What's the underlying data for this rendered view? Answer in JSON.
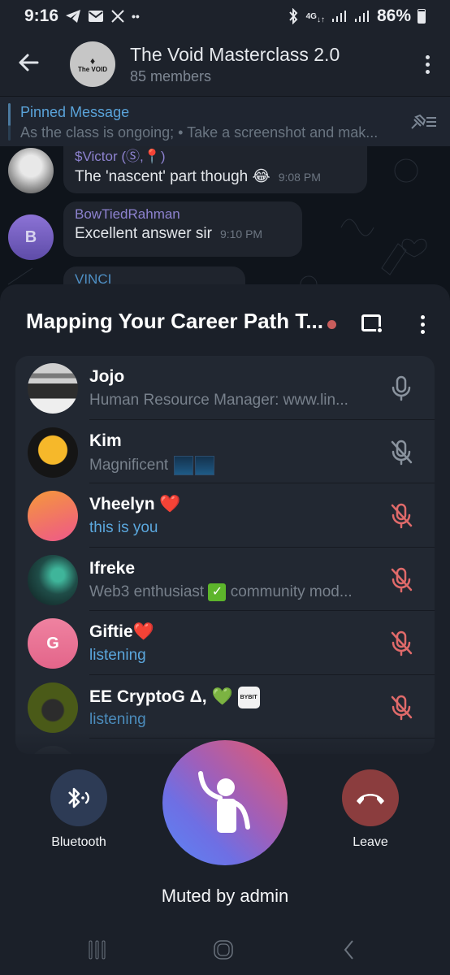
{
  "status_bar": {
    "time": "9:16",
    "notification_icons": [
      "telegram-icon",
      "mail-icon",
      "x-icon",
      "more-dots-icon"
    ],
    "network": "4G",
    "battery": "86%",
    "battery_level": 0.86
  },
  "header": {
    "title": "The Void Masterclass 2.0",
    "subtitle": "85 members",
    "avatar_text": "The VOID"
  },
  "pinned": {
    "title": "Pinned Message",
    "text": "As the class is ongoing;  • Take a screenshot and mak..."
  },
  "messages": [
    {
      "sender": "$Victor (Ⓢ,📍)",
      "text": "The 'nascent' part though 😂",
      "time": "9:08 PM"
    },
    {
      "sender": "BowTiedRahman",
      "avatar_letter": "B",
      "text": "Excellent answer sir",
      "time": "9:10 PM"
    },
    {
      "sender": "VINCI"
    }
  ],
  "call": {
    "title": "Mapping Your Career Path T...",
    "recording": true,
    "participants": [
      {
        "name": "Jojo",
        "status": "Human Resource Manager: www.lin...",
        "status_type": "bio",
        "mic": "on"
      },
      {
        "name": "Kim",
        "status": "Magnificent",
        "status_emoji": "fireworks",
        "status_type": "bio",
        "mic": "muted"
      },
      {
        "name": "Vheelyn",
        "name_emoji": "❤️",
        "status": "this is you",
        "status_type": "self",
        "mic": "muted-by-admin"
      },
      {
        "name": "Ifreke",
        "status_prefix": "Web3 enthusiast",
        "status": "community mod...",
        "status_type": "bio",
        "mic": "muted-by-admin"
      },
      {
        "name": "Giftie",
        "name_emoji": "❤️",
        "avatar_letter": "G",
        "status": "listening",
        "status_type": "listening",
        "mic": "muted-by-admin"
      },
      {
        "name": "EE CryptoG Δ,",
        "name_emoji": "💚",
        "name_badge": "BYBIT",
        "status": "listening",
        "status_type": "listening",
        "mic": "muted-by-admin"
      }
    ],
    "controls": {
      "bluetooth_label": "Bluetooth",
      "leave_label": "Leave",
      "state_label": "Muted by admin"
    }
  },
  "colors": {
    "accent_blue": "#5ba7dd",
    "muted_red": "#e06a6a",
    "leave_red": "#8b3d3e",
    "bluetooth_bg": "#2d3b55"
  }
}
